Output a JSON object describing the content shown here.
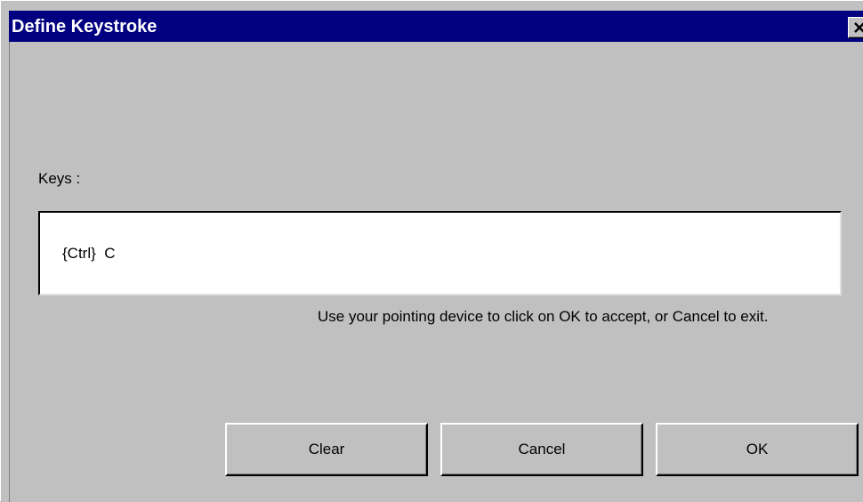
{
  "window": {
    "title": "Define Keystroke",
    "close_icon": "close-icon"
  },
  "keys": {
    "label": "Keys :",
    "value": "{Ctrl}  C"
  },
  "hint": "Use your pointing device to click on OK to accept, or Cancel to exit.",
  "buttons": {
    "clear": "Clear",
    "cancel": "Cancel",
    "ok": "OK"
  },
  "colors": {
    "title_bar": "#000080",
    "dialog_bg": "#c0c0c0",
    "field_bg": "#ffffff"
  }
}
